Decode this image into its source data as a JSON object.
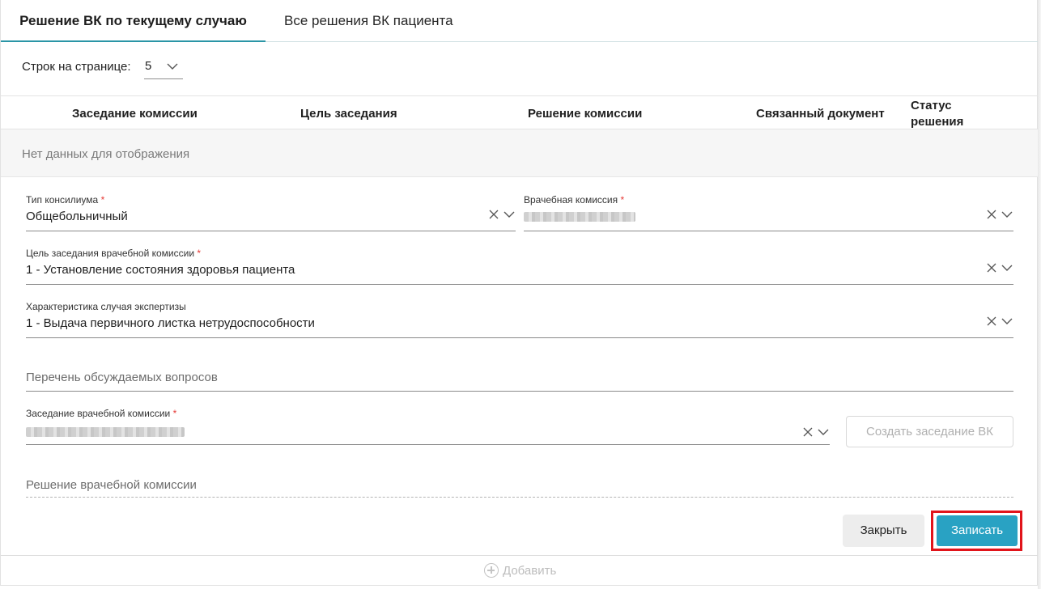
{
  "tabs": [
    {
      "label": "Решение ВК по текущему случаю",
      "active": true
    },
    {
      "label": "Все решения ВК пациента",
      "active": false
    }
  ],
  "rows_per_page": {
    "label": "Строк на странице:",
    "value": "5"
  },
  "table": {
    "columns": [
      "Заседание комиссии",
      "Цель заседания",
      "Решение комиссии",
      "Связанный документ",
      "Статус решения"
    ],
    "empty_text": "Нет данных для отображения"
  },
  "form": {
    "consilium_type": {
      "label": "Тип консилиума",
      "value": "Общебольничный",
      "required": "*"
    },
    "medical_commission": {
      "label": "Врачебная комиссия",
      "value": "",
      "required": "*"
    },
    "meeting_goal": {
      "label": "Цель заседания врачебной комиссии",
      "value": "1 - Установление состояния здоровья пациента",
      "required": "*"
    },
    "case_characteristic": {
      "label": "Характеристика случая экспертизы",
      "value": "1 - Выдача первичного листка нетрудоспособности"
    },
    "questions": {
      "placeholder": "Перечень обсуждаемых вопросов"
    },
    "commission_meeting": {
      "label": "Заседание врачебной комиссии",
      "value": "",
      "required": "*"
    },
    "commission_decision": {
      "placeholder": "Решение врачебной комиссии"
    }
  },
  "buttons": {
    "create_meeting": "Создать заседание ВК",
    "close": "Закрыть",
    "save": "Записать",
    "add": "Добавить"
  },
  "colors": {
    "accent": "#2a95a6",
    "save": "#29a2c3",
    "highlight": "#e1141b",
    "required": "#e53935"
  }
}
